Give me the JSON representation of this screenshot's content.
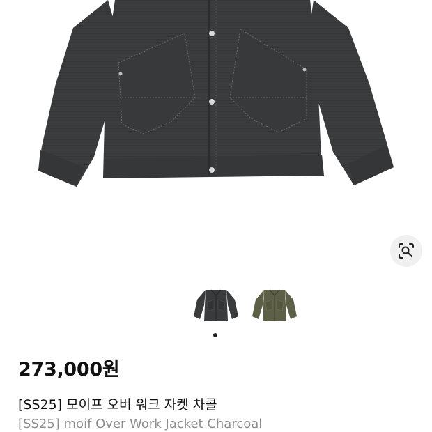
{
  "product": {
    "price": "273,000원",
    "title_ko": "[SS25] 모이프 오버 워크 자켓 차콜",
    "title_en": "[SS25] moif Over Work Jacket Charcoal"
  },
  "gallery": {
    "thumbnails": [
      {
        "name": "charcoal",
        "color": "#3a3b3d"
      },
      {
        "name": "olive",
        "color": "#5d6047"
      }
    ],
    "active_index": 0,
    "lens_icon": "visual-search-icon"
  },
  "colors": {
    "jacket_charcoal": "#3b3c3e",
    "jacket_olive": "#5b5e45",
    "price_text": "#111111",
    "subtitle_text": "#8e8e8e"
  }
}
